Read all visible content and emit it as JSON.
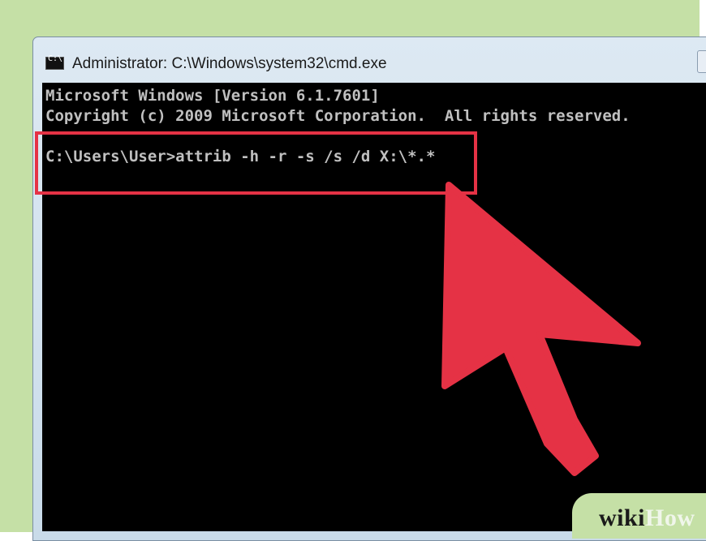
{
  "window": {
    "title": "Administrator: C:\\Windows\\system32\\cmd.exe",
    "icon": "cmd-icon",
    "icon_glyph": "C:\\"
  },
  "console": {
    "lines": [
      "Microsoft Windows [Version 6.1.7601]",
      "Copyright (c) 2009 Microsoft Corporation.  All rights reserved.",
      "",
      "C:\\Users\\User>attrib -h -r -s /s /d X:\\*.*"
    ],
    "text_color": "#c0c0c0",
    "background": "#000000"
  },
  "annotation": {
    "highlight_color": "#e53245",
    "arrow_color": "#e53245"
  },
  "watermark": {
    "part1": "wiki",
    "part2": "How"
  }
}
